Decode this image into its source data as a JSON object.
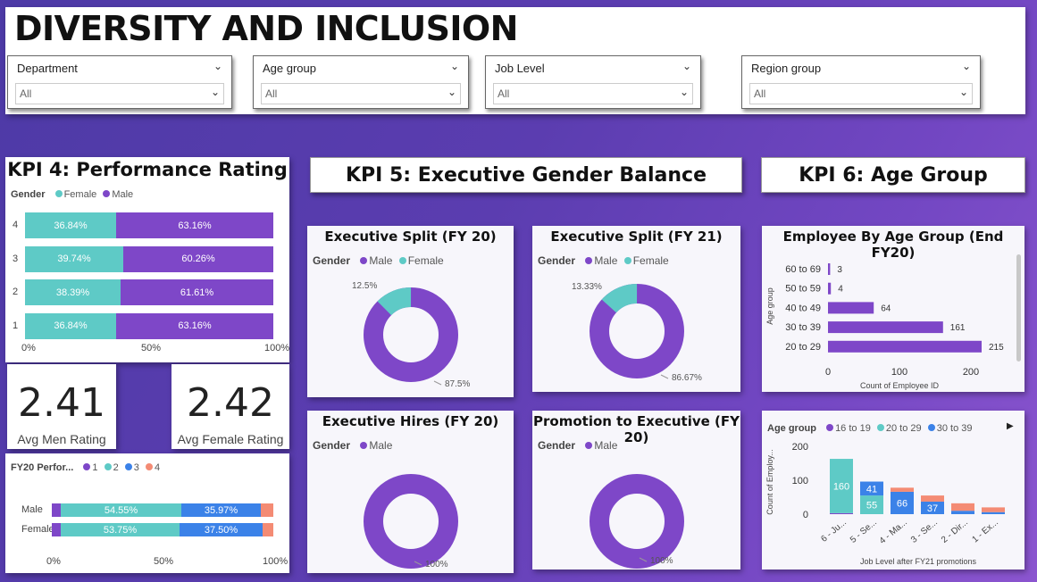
{
  "header": {
    "title": "DIVERSITY AND INCLUSION",
    "slicers": [
      {
        "label": "Department",
        "value": "All"
      },
      {
        "label": "Age group",
        "value": "All"
      },
      {
        "label": "Job Level",
        "value": "All"
      },
      {
        "label": "Region group",
        "value": "All"
      }
    ]
  },
  "colors": {
    "teal": "#5ecac6",
    "purple": "#7e47c8",
    "blue": "#3b82e8",
    "salmon": "#f48b74"
  },
  "kpi4": {
    "title": "KPI 4: Performance Rating",
    "legend_title": "Gender",
    "legend": [
      "Female",
      "Male"
    ],
    "rows": [
      {
        "label": "4",
        "female": "36.84%",
        "male": "63.16%",
        "female_frac": 0.3684
      },
      {
        "label": "3",
        "female": "39.74%",
        "male": "60.26%",
        "female_frac": 0.3974
      },
      {
        "label": "2",
        "female": "38.39%",
        "male": "61.61%",
        "female_frac": 0.3839
      },
      {
        "label": "1",
        "female": "36.84%",
        "male": "63.16%",
        "female_frac": 0.3684
      }
    ],
    "axis": [
      "0%",
      "50%",
      "100%"
    ]
  },
  "cards": {
    "men": {
      "value": "2.41",
      "label": "Avg Men Rating"
    },
    "women": {
      "value": "2.42",
      "label": "Avg Female Rating"
    }
  },
  "fy20perf": {
    "legend_title": "FY20 Perfor...",
    "legend": [
      "1",
      "2",
      "3",
      "4"
    ],
    "rows": [
      {
        "label": "Male",
        "values": [
          "",
          "54.55%",
          "35.97%",
          ""
        ],
        "fracs": [
          0.04,
          0.5455,
          0.3597,
          0.0548
        ]
      },
      {
        "label": "Female",
        "values": [
          "",
          "53.75%",
          "37.50%",
          ""
        ],
        "fracs": [
          0.04,
          0.5375,
          0.375,
          0.0475
        ]
      }
    ],
    "axis": [
      "0%",
      "50%",
      "100%"
    ]
  },
  "kpi5": {
    "title": "KPI 5: Executive Gender Balance",
    "split20": {
      "title": "Executive Split (FY 20)",
      "legend_title": "Gender",
      "legend": [
        "Male",
        "Female"
      ],
      "male_pct": 87.5,
      "male_label": "87.5%",
      "female_label": "12.5%"
    },
    "split21": {
      "title": "Executive Split (FY 21)",
      "legend_title": "Gender",
      "legend": [
        "Male",
        "Female"
      ],
      "male_pct": 86.67,
      "male_label": "86.67%",
      "female_label": "13.33%"
    },
    "hires": {
      "title": "Executive Hires (FY 20)",
      "legend_title": "Gender",
      "legend": [
        "Male"
      ],
      "label": "100%"
    },
    "promo": {
      "title": "Promotion to Executive (FY 20)",
      "legend_title": "Gender",
      "legend": [
        "Male"
      ],
      "label": "100%"
    }
  },
  "kpi6": {
    "title": "KPI 6: Age Group",
    "agechart": {
      "title": "Employee By Age Group (End FY20)",
      "ylabel": "Age group",
      "xlabel": "Count of Employee ID",
      "categories": [
        "60 to 69",
        "50 to 59",
        "40 to 49",
        "30 to 39",
        "20 to 29"
      ],
      "values": [
        3,
        4,
        64,
        161,
        215
      ],
      "xticks": [
        "0",
        "100",
        "200"
      ]
    },
    "stacked": {
      "legend_title": "Age group",
      "legend": [
        "16 to 19",
        "20 to 29",
        "30 to 39"
      ],
      "ylabel": "Count of Employ...",
      "xlabel": "Job Level after FY21 promotions",
      "categories": [
        "6 - Ju...",
        "5 - Se...",
        "4 - Ma...",
        "3 - Se...",
        "2 - Dir...",
        "1 - Ex..."
      ],
      "yticks": [
        "200",
        "100",
        "0"
      ],
      "bars": [
        {
          "purple": 3,
          "teal": 160,
          "blue": 0,
          "salmon": 0,
          "labels": {
            "teal": "160"
          }
        },
        {
          "purple": 0,
          "teal": 55,
          "blue": 41,
          "salmon": 0,
          "labels": {
            "teal": "55",
            "blue": "41"
          }
        },
        {
          "purple": 0,
          "teal": 0,
          "blue": 66,
          "salmon": 12,
          "labels": {
            "blue": "66"
          }
        },
        {
          "purple": 0,
          "teal": 0,
          "blue": 37,
          "salmon": 18,
          "labels": {
            "blue": "37"
          }
        },
        {
          "purple": 0,
          "teal": 0,
          "blue": 10,
          "salmon": 22,
          "labels": {}
        },
        {
          "purple": 0,
          "teal": 0,
          "blue": 6,
          "salmon": 14,
          "labels": {}
        }
      ]
    }
  }
}
